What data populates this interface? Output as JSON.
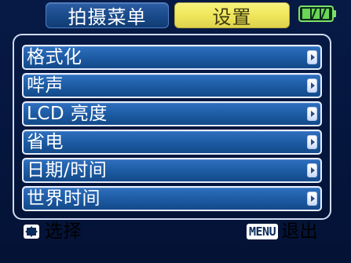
{
  "tabs": {
    "shoot_menu": "拍摄菜单",
    "settings": "设置"
  },
  "battery": {
    "level": "full",
    "color": "#6fd35a"
  },
  "menu": {
    "items": [
      {
        "label": "格式化"
      },
      {
        "label": "哔声"
      },
      {
        "label": "LCD 亮度"
      },
      {
        "label": "省电"
      },
      {
        "label": "日期/时间"
      },
      {
        "label": "世界时间"
      }
    ]
  },
  "bottom_bar": {
    "select_label": "选择",
    "menu_key": "MENU",
    "exit_label": "退出"
  },
  "colors": {
    "active_tab": "#efe55a",
    "inactive_tab": "#184887",
    "menu_item": "#1c5aa2",
    "background": "#05173f"
  },
  "icons": {
    "select": "four-way-dpad-icon",
    "item_arrow": "chevron-right-icon"
  }
}
